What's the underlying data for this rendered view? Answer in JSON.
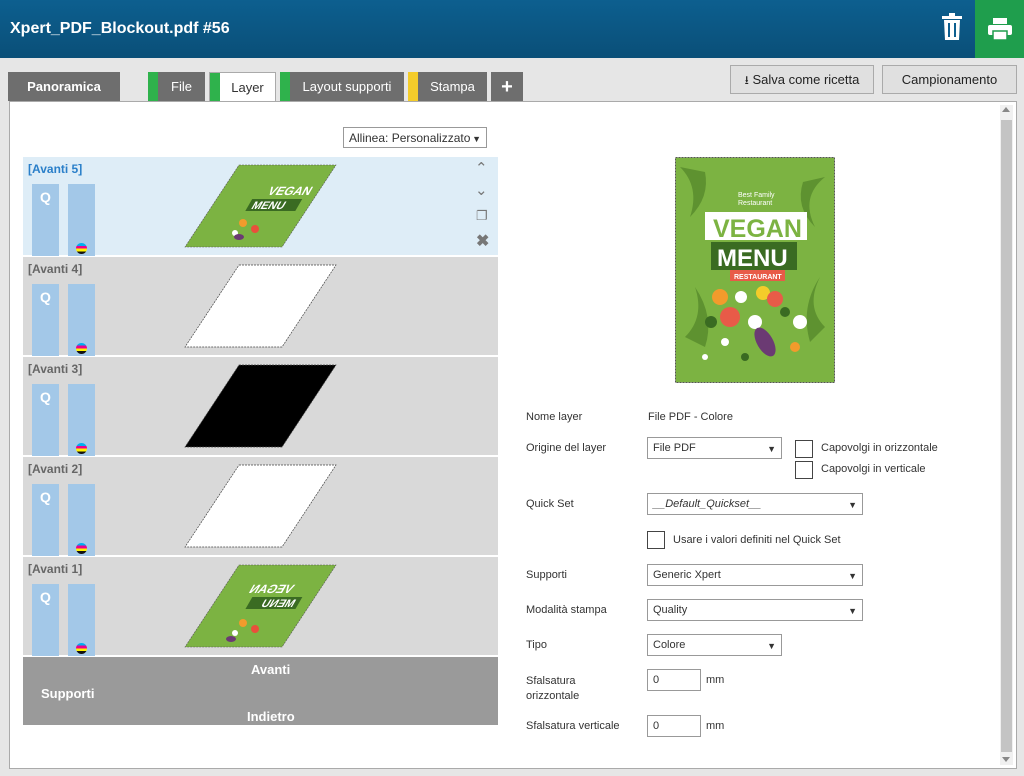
{
  "header": {
    "title": "Xpert_PDF_Blockout.pdf #56"
  },
  "tabs": [
    {
      "label": "Panoramica"
    },
    {
      "label": "File",
      "color": "#2fb24c"
    },
    {
      "label": "Layer",
      "color": "#2fb24c"
    },
    {
      "label": "Layout supporti",
      "color": "#2fb24c"
    },
    {
      "label": "Stampa",
      "color": "#f4cc2a"
    },
    {
      "label": "+"
    }
  ],
  "toolbar": {
    "save_recipe": "Salva come ricetta",
    "sampling": "Campionamento"
  },
  "align_select": {
    "value": "Allinea: Personalizzato"
  },
  "layers": [
    {
      "label": "[Avanti 5]",
      "q": "Q",
      "thumb": "image"
    },
    {
      "label": "[Avanti 4]",
      "q": "Q",
      "thumb": "white"
    },
    {
      "label": "[Avanti 3]",
      "q": "Q",
      "thumb": "black"
    },
    {
      "label": "[Avanti 2]",
      "q": "Q",
      "thumb": "white"
    },
    {
      "label": "[Avanti 1]",
      "q": "Q",
      "thumb": "image-flipped"
    }
  ],
  "footer": {
    "front": "Avanti",
    "media": "Supporti",
    "back": "Indietro"
  },
  "preview": {
    "line1": "Best Family",
    "line2": "Restaurant",
    "vegan": "VEGAN",
    "menu": "MENU",
    "restaurant": "RESTAURANT"
  },
  "props": {
    "layer_name_label": "Nome layer",
    "layer_name_value": "File PDF - Colore",
    "origin_label": "Origine del layer",
    "origin_value": "File PDF",
    "flip_h": "Capovolgi in orizzontale",
    "flip_v": "Capovolgi in verticale",
    "quickset_label": "Quick Set",
    "quickset_value": "__Default_Quickset__",
    "use_quickset": "Usare i valori definiti nel Quick Set",
    "media_label": "Supporti",
    "media_value": "Generic Xpert",
    "print_mode_label": "Modalità stampa",
    "print_mode_value": "Quality",
    "type_label": "Tipo",
    "type_value": "Colore",
    "offset_h_label1": "Sfalsatura",
    "offset_h_label2": "orizzontale",
    "offset_h_value": "0",
    "offset_v_label": "Sfalsatura verticale",
    "offset_v_value": "0",
    "unit": "mm"
  },
  "colors": {
    "header": "#0d5f8f",
    "accent_green": "#2fb24c",
    "accent_yellow": "#f4cc2a",
    "menu_green": "#7cb342"
  }
}
